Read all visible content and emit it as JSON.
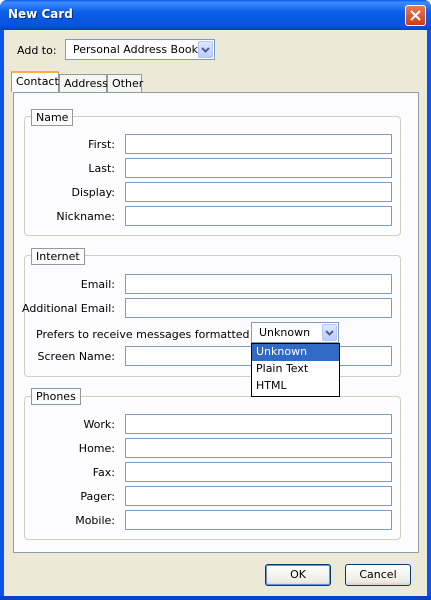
{
  "window": {
    "title": "New Card",
    "close_icon": "close-icon"
  },
  "add_to": {
    "label": "Add to:",
    "value": "Personal Address Book"
  },
  "tabs": [
    {
      "label": "Contact",
      "active": true
    },
    {
      "label": "Address",
      "active": false
    },
    {
      "label": "Other",
      "active": false
    }
  ],
  "name_group": {
    "title": "Name",
    "first_label": "First:",
    "first_value": "",
    "last_label": "Last:",
    "last_value": "",
    "display_label": "Display:",
    "display_value": "",
    "nickname_label": "Nickname:",
    "nickname_value": ""
  },
  "internet_group": {
    "title": "Internet",
    "email_label": "Email:",
    "email_value": "",
    "additional_email_label": "Additional Email:",
    "additional_email_value": "",
    "prefers_label": "Prefers to receive messages formatted as:",
    "prefers_value": "Unknown",
    "prefers_options": [
      "Unknown",
      "Plain Text",
      "HTML"
    ],
    "screen_name_label": "Screen Name:",
    "screen_name_value": ""
  },
  "phones_group": {
    "title": "Phones",
    "work_label": "Work:",
    "work_value": "",
    "home_label": "Home:",
    "home_value": "",
    "fax_label": "Fax:",
    "fax_value": "",
    "pager_label": "Pager:",
    "pager_value": "",
    "mobile_label": "Mobile:",
    "mobile_value": ""
  },
  "buttons": {
    "ok": "OK",
    "cancel": "Cancel"
  },
  "colors": {
    "titlebar": "#0a5bf0",
    "dialog_bg": "#ece9d8",
    "selection": "#316ac5",
    "tab_accent": "#f7b23b"
  }
}
